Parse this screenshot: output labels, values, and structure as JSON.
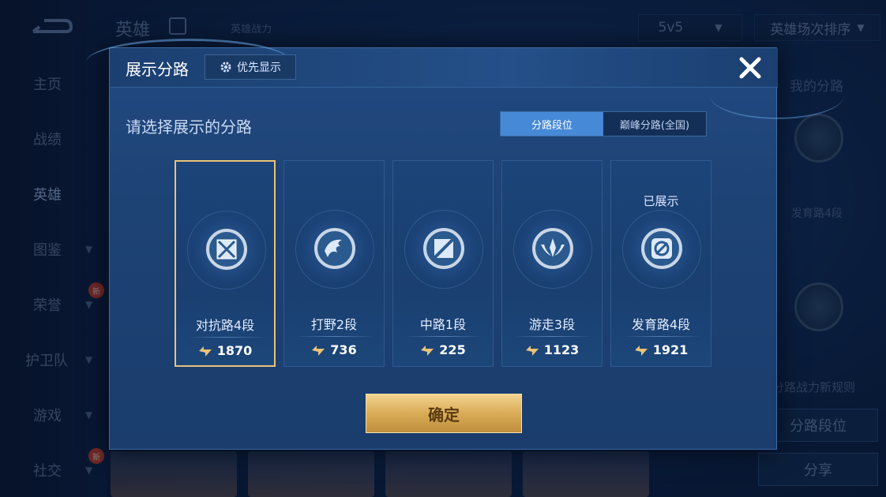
{
  "background": {
    "top_title": "英雄",
    "top_subtitle": "英雄战力",
    "mode_select": "5v5",
    "sort_select": "英雄场次排序",
    "sidebar": [
      {
        "label": "主页",
        "has_chevron": false,
        "new": false
      },
      {
        "label": "战绩",
        "has_chevron": false,
        "new": false
      },
      {
        "label": "英雄",
        "has_chevron": false,
        "new": false,
        "active": true
      },
      {
        "label": "图鉴",
        "has_chevron": true,
        "new": false
      },
      {
        "label": "荣誉",
        "has_chevron": true,
        "new": true
      },
      {
        "label": "护卫队",
        "has_chevron": true,
        "new": false
      },
      {
        "label": "游戏",
        "has_chevron": true,
        "new": false
      },
      {
        "label": "社交",
        "has_chevron": true,
        "new": true
      }
    ],
    "new_badge": "新",
    "right_panel": {
      "title": "我的分路",
      "lane_label": "发育路4段",
      "rule_text": "分路战力新规则",
      "lane_rank_button": "分路段位",
      "share_button": "分享"
    }
  },
  "dialog": {
    "title": "展示分路",
    "priority_button": "优先显示",
    "section_title": "请选择展示的分路",
    "tabs": [
      {
        "label": "分路段位",
        "active": true
      },
      {
        "label": "巅峰分路(全国)",
        "active": false
      }
    ],
    "lanes": [
      {
        "name": "对抗路4段",
        "score": "1870",
        "icon": "clash-lane-icon",
        "selected": true,
        "shown": false
      },
      {
        "name": "打野2段",
        "score": "736",
        "icon": "jungle-icon",
        "selected": false,
        "shown": false
      },
      {
        "name": "中路1段",
        "score": "225",
        "icon": "mid-lane-icon",
        "selected": false,
        "shown": false
      },
      {
        "name": "游走3段",
        "score": "1123",
        "icon": "roam-icon",
        "selected": false,
        "shown": false
      },
      {
        "name": "发育路4段",
        "score": "1921",
        "icon": "farm-lane-icon",
        "selected": false,
        "shown": true
      }
    ],
    "shown_label": "已展示",
    "confirm_button": "确定"
  },
  "colors": {
    "accent_gold": "#e8c27a",
    "tab_active": "#4689d6",
    "dialog_bg": "#1d4274"
  }
}
